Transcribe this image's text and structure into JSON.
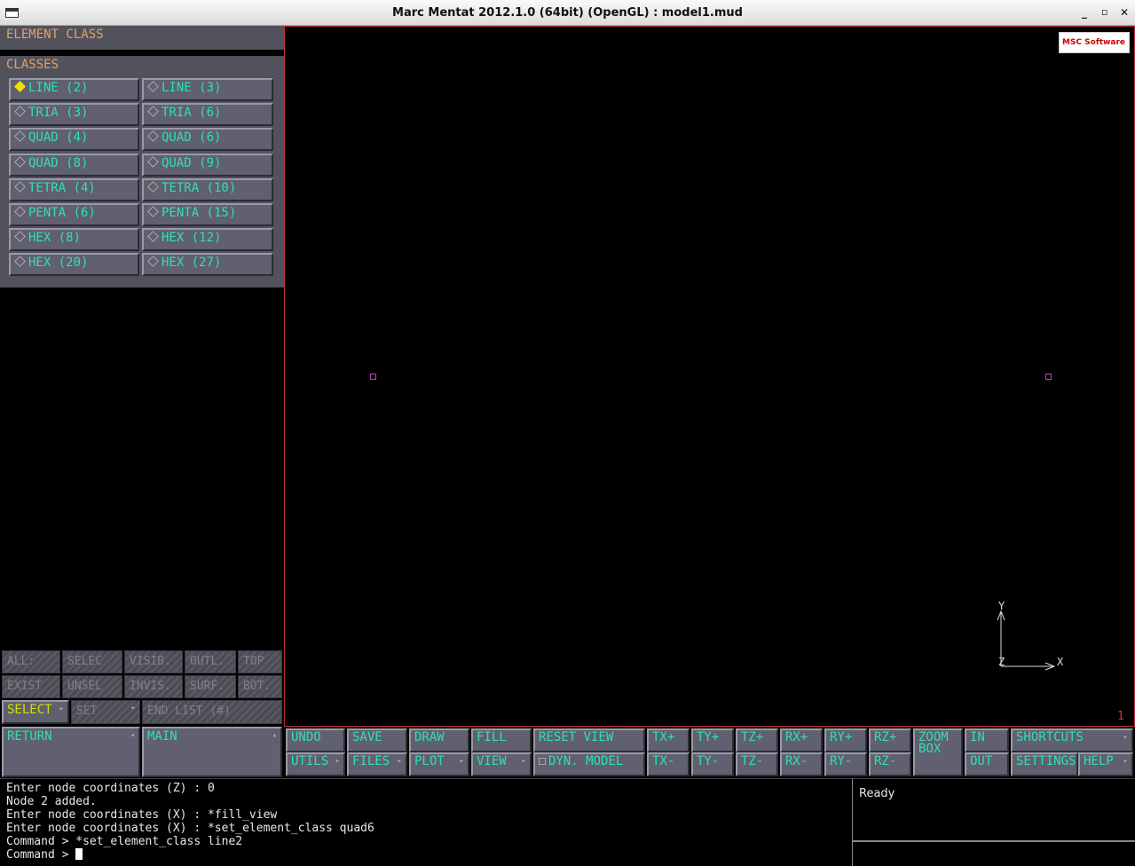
{
  "window": {
    "title": "Marc Mentat 2012.1.0 (64bit) (OpenGL) : model1.mud",
    "minimize": "_",
    "maximize": "▫",
    "close": "✕"
  },
  "left_panel": {
    "header": "ELEMENT CLASS",
    "classes_label": "CLASSES",
    "classes": [
      {
        "label": "LINE (2)",
        "selected": true
      },
      {
        "label": "LINE (3)",
        "selected": false
      },
      {
        "label": "TRIA (3)",
        "selected": false
      },
      {
        "label": "TRIA (6)",
        "selected": false
      },
      {
        "label": "QUAD (4)",
        "selected": false
      },
      {
        "label": "QUAD (6)",
        "selected": false
      },
      {
        "label": "QUAD (8)",
        "selected": false
      },
      {
        "label": "QUAD (9)",
        "selected": false
      },
      {
        "label": "TETRA (4)",
        "selected": false
      },
      {
        "label": "TETRA (10)",
        "selected": false
      },
      {
        "label": "PENTA (6)",
        "selected": false
      },
      {
        "label": "PENTA (15)",
        "selected": false
      },
      {
        "label": "HEX (8)",
        "selected": false
      },
      {
        "label": "HEX (12)",
        "selected": false
      },
      {
        "label": "HEX (20)",
        "selected": false
      },
      {
        "label": "HEX (27)",
        "selected": false
      }
    ],
    "selection_row1": [
      "ALL:",
      "SELEC",
      "VISIB.",
      "OUTL.",
      "TOP"
    ],
    "selection_row2": [
      "EXIST",
      "UNSEL",
      "INVIS.",
      "SURF.",
      "BOT."
    ],
    "select": "SELECT",
    "set": "SET",
    "end_list": "END LIST (#)",
    "return": "RETURN",
    "main": "MAIN"
  },
  "viewport": {
    "logo": "MSC Software",
    "axis_y": "Y",
    "axis_x": "X",
    "axis_z": "Z",
    "window_number": "1"
  },
  "toolbar": {
    "undo": "UNDO",
    "save": "SAVE",
    "draw": "DRAW",
    "fill": "FILL",
    "reset_view": "RESET VIEW",
    "utils": "UTILS",
    "files": "FILES",
    "plot": "PLOT",
    "view": "VIEW",
    "dyn_model": "DYN. MODEL",
    "tx_plus": "TX+",
    "ty_plus": "TY+",
    "tz_plus": "TZ+",
    "rx_plus": "RX+",
    "ry_plus": "RY+",
    "rz_plus": "RZ+",
    "tx_minus": "TX-",
    "ty_minus": "TY-",
    "tz_minus": "TZ-",
    "rx_minus": "RX-",
    "ry_minus": "RY-",
    "rz_minus": "RZ-",
    "zoom_box_1": "ZOOM",
    "zoom_box_2": "BOX",
    "in": "IN",
    "out": "OUT",
    "shortcuts": "SHORTCUTS",
    "settings": "SETTINGS",
    "help": "HELP"
  },
  "console": {
    "lines": [
      "Enter node coordinates (Z) : 0",
      "Node 2 added.",
      "Enter node coordinates (X) : *fill_view",
      "Enter node coordinates (X) : *set_element_class quad6",
      "Command > *set_element_class line2"
    ],
    "prompt": "Command > "
  },
  "status": {
    "text": "Ready"
  }
}
